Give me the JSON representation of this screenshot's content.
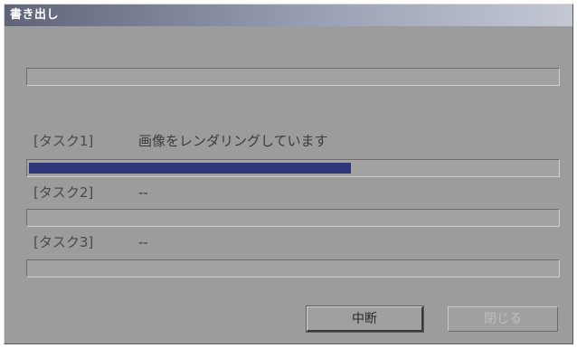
{
  "window": {
    "title": "書き出し"
  },
  "overall": {
    "progress": 0
  },
  "tasks": [
    {
      "label": "[タスク1]",
      "status": "画像をレンダリングしています",
      "progress": 0.61
    },
    {
      "label": "[タスク2]",
      "status": "--",
      "progress": 0
    },
    {
      "label": "[タスク3]",
      "status": "--",
      "progress": 0
    }
  ],
  "buttons": {
    "abort_label": "中断",
    "close_label": "閉じる",
    "close_enabled": false
  },
  "colors": {
    "progress_fill": "#2f3678",
    "dialog_background": "#9c9c9c"
  }
}
